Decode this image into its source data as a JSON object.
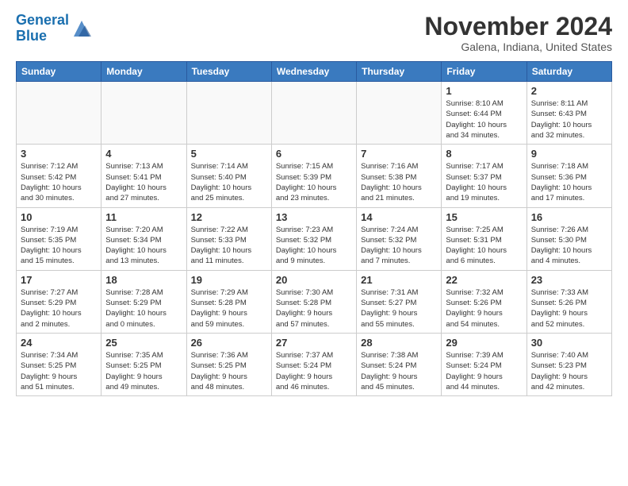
{
  "header": {
    "logo_line1": "General",
    "logo_line2": "Blue",
    "month_title": "November 2024",
    "location": "Galena, Indiana, United States"
  },
  "weekdays": [
    "Sunday",
    "Monday",
    "Tuesday",
    "Wednesday",
    "Thursday",
    "Friday",
    "Saturday"
  ],
  "weeks": [
    [
      {
        "day": "",
        "info": ""
      },
      {
        "day": "",
        "info": ""
      },
      {
        "day": "",
        "info": ""
      },
      {
        "day": "",
        "info": ""
      },
      {
        "day": "",
        "info": ""
      },
      {
        "day": "1",
        "info": "Sunrise: 8:10 AM\nSunset: 6:44 PM\nDaylight: 10 hours\nand 34 minutes."
      },
      {
        "day": "2",
        "info": "Sunrise: 8:11 AM\nSunset: 6:43 PM\nDaylight: 10 hours\nand 32 minutes."
      }
    ],
    [
      {
        "day": "3",
        "info": "Sunrise: 7:12 AM\nSunset: 5:42 PM\nDaylight: 10 hours\nand 30 minutes."
      },
      {
        "day": "4",
        "info": "Sunrise: 7:13 AM\nSunset: 5:41 PM\nDaylight: 10 hours\nand 27 minutes."
      },
      {
        "day": "5",
        "info": "Sunrise: 7:14 AM\nSunset: 5:40 PM\nDaylight: 10 hours\nand 25 minutes."
      },
      {
        "day": "6",
        "info": "Sunrise: 7:15 AM\nSunset: 5:39 PM\nDaylight: 10 hours\nand 23 minutes."
      },
      {
        "day": "7",
        "info": "Sunrise: 7:16 AM\nSunset: 5:38 PM\nDaylight: 10 hours\nand 21 minutes."
      },
      {
        "day": "8",
        "info": "Sunrise: 7:17 AM\nSunset: 5:37 PM\nDaylight: 10 hours\nand 19 minutes."
      },
      {
        "day": "9",
        "info": "Sunrise: 7:18 AM\nSunset: 5:36 PM\nDaylight: 10 hours\nand 17 minutes."
      }
    ],
    [
      {
        "day": "10",
        "info": "Sunrise: 7:19 AM\nSunset: 5:35 PM\nDaylight: 10 hours\nand 15 minutes."
      },
      {
        "day": "11",
        "info": "Sunrise: 7:20 AM\nSunset: 5:34 PM\nDaylight: 10 hours\nand 13 minutes."
      },
      {
        "day": "12",
        "info": "Sunrise: 7:22 AM\nSunset: 5:33 PM\nDaylight: 10 hours\nand 11 minutes."
      },
      {
        "day": "13",
        "info": "Sunrise: 7:23 AM\nSunset: 5:32 PM\nDaylight: 10 hours\nand 9 minutes."
      },
      {
        "day": "14",
        "info": "Sunrise: 7:24 AM\nSunset: 5:32 PM\nDaylight: 10 hours\nand 7 minutes."
      },
      {
        "day": "15",
        "info": "Sunrise: 7:25 AM\nSunset: 5:31 PM\nDaylight: 10 hours\nand 6 minutes."
      },
      {
        "day": "16",
        "info": "Sunrise: 7:26 AM\nSunset: 5:30 PM\nDaylight: 10 hours\nand 4 minutes."
      }
    ],
    [
      {
        "day": "17",
        "info": "Sunrise: 7:27 AM\nSunset: 5:29 PM\nDaylight: 10 hours\nand 2 minutes."
      },
      {
        "day": "18",
        "info": "Sunrise: 7:28 AM\nSunset: 5:29 PM\nDaylight: 10 hours\nand 0 minutes."
      },
      {
        "day": "19",
        "info": "Sunrise: 7:29 AM\nSunset: 5:28 PM\nDaylight: 9 hours\nand 59 minutes."
      },
      {
        "day": "20",
        "info": "Sunrise: 7:30 AM\nSunset: 5:28 PM\nDaylight: 9 hours\nand 57 minutes."
      },
      {
        "day": "21",
        "info": "Sunrise: 7:31 AM\nSunset: 5:27 PM\nDaylight: 9 hours\nand 55 minutes."
      },
      {
        "day": "22",
        "info": "Sunrise: 7:32 AM\nSunset: 5:26 PM\nDaylight: 9 hours\nand 54 minutes."
      },
      {
        "day": "23",
        "info": "Sunrise: 7:33 AM\nSunset: 5:26 PM\nDaylight: 9 hours\nand 52 minutes."
      }
    ],
    [
      {
        "day": "24",
        "info": "Sunrise: 7:34 AM\nSunset: 5:25 PM\nDaylight: 9 hours\nand 51 minutes."
      },
      {
        "day": "25",
        "info": "Sunrise: 7:35 AM\nSunset: 5:25 PM\nDaylight: 9 hours\nand 49 minutes."
      },
      {
        "day": "26",
        "info": "Sunrise: 7:36 AM\nSunset: 5:25 PM\nDaylight: 9 hours\nand 48 minutes."
      },
      {
        "day": "27",
        "info": "Sunrise: 7:37 AM\nSunset: 5:24 PM\nDaylight: 9 hours\nand 46 minutes."
      },
      {
        "day": "28",
        "info": "Sunrise: 7:38 AM\nSunset: 5:24 PM\nDaylight: 9 hours\nand 45 minutes."
      },
      {
        "day": "29",
        "info": "Sunrise: 7:39 AM\nSunset: 5:24 PM\nDaylight: 9 hours\nand 44 minutes."
      },
      {
        "day": "30",
        "info": "Sunrise: 7:40 AM\nSunset: 5:23 PM\nDaylight: 9 hours\nand 42 minutes."
      }
    ]
  ]
}
